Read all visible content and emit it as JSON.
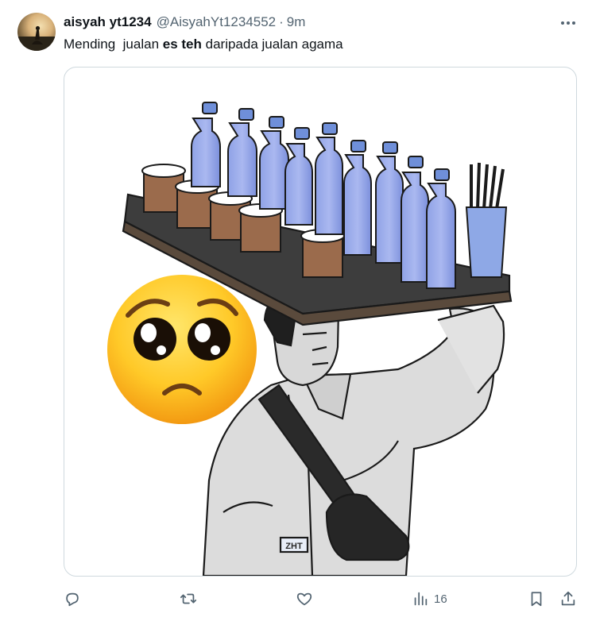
{
  "author": {
    "display_name": "aisyah yt1234",
    "handle": "@AisyahYt1234552",
    "separator": "·",
    "time": "9m"
  },
  "tweet": {
    "text_before": "Mending  jualan ",
    "text_bold": "es teh",
    "text_after": " daripada jualan agama"
  },
  "media": {
    "image_text": "ZHT",
    "description_icons": [
      "pleading-face-emoji",
      "street-vendor-illustration"
    ]
  },
  "actions": {
    "reply_count": "",
    "retweet_count": "",
    "like_count": "",
    "views_count": "16"
  },
  "colors": {
    "text_primary": "#0f1419",
    "text_secondary": "#536471",
    "border": "#cfd9de"
  }
}
